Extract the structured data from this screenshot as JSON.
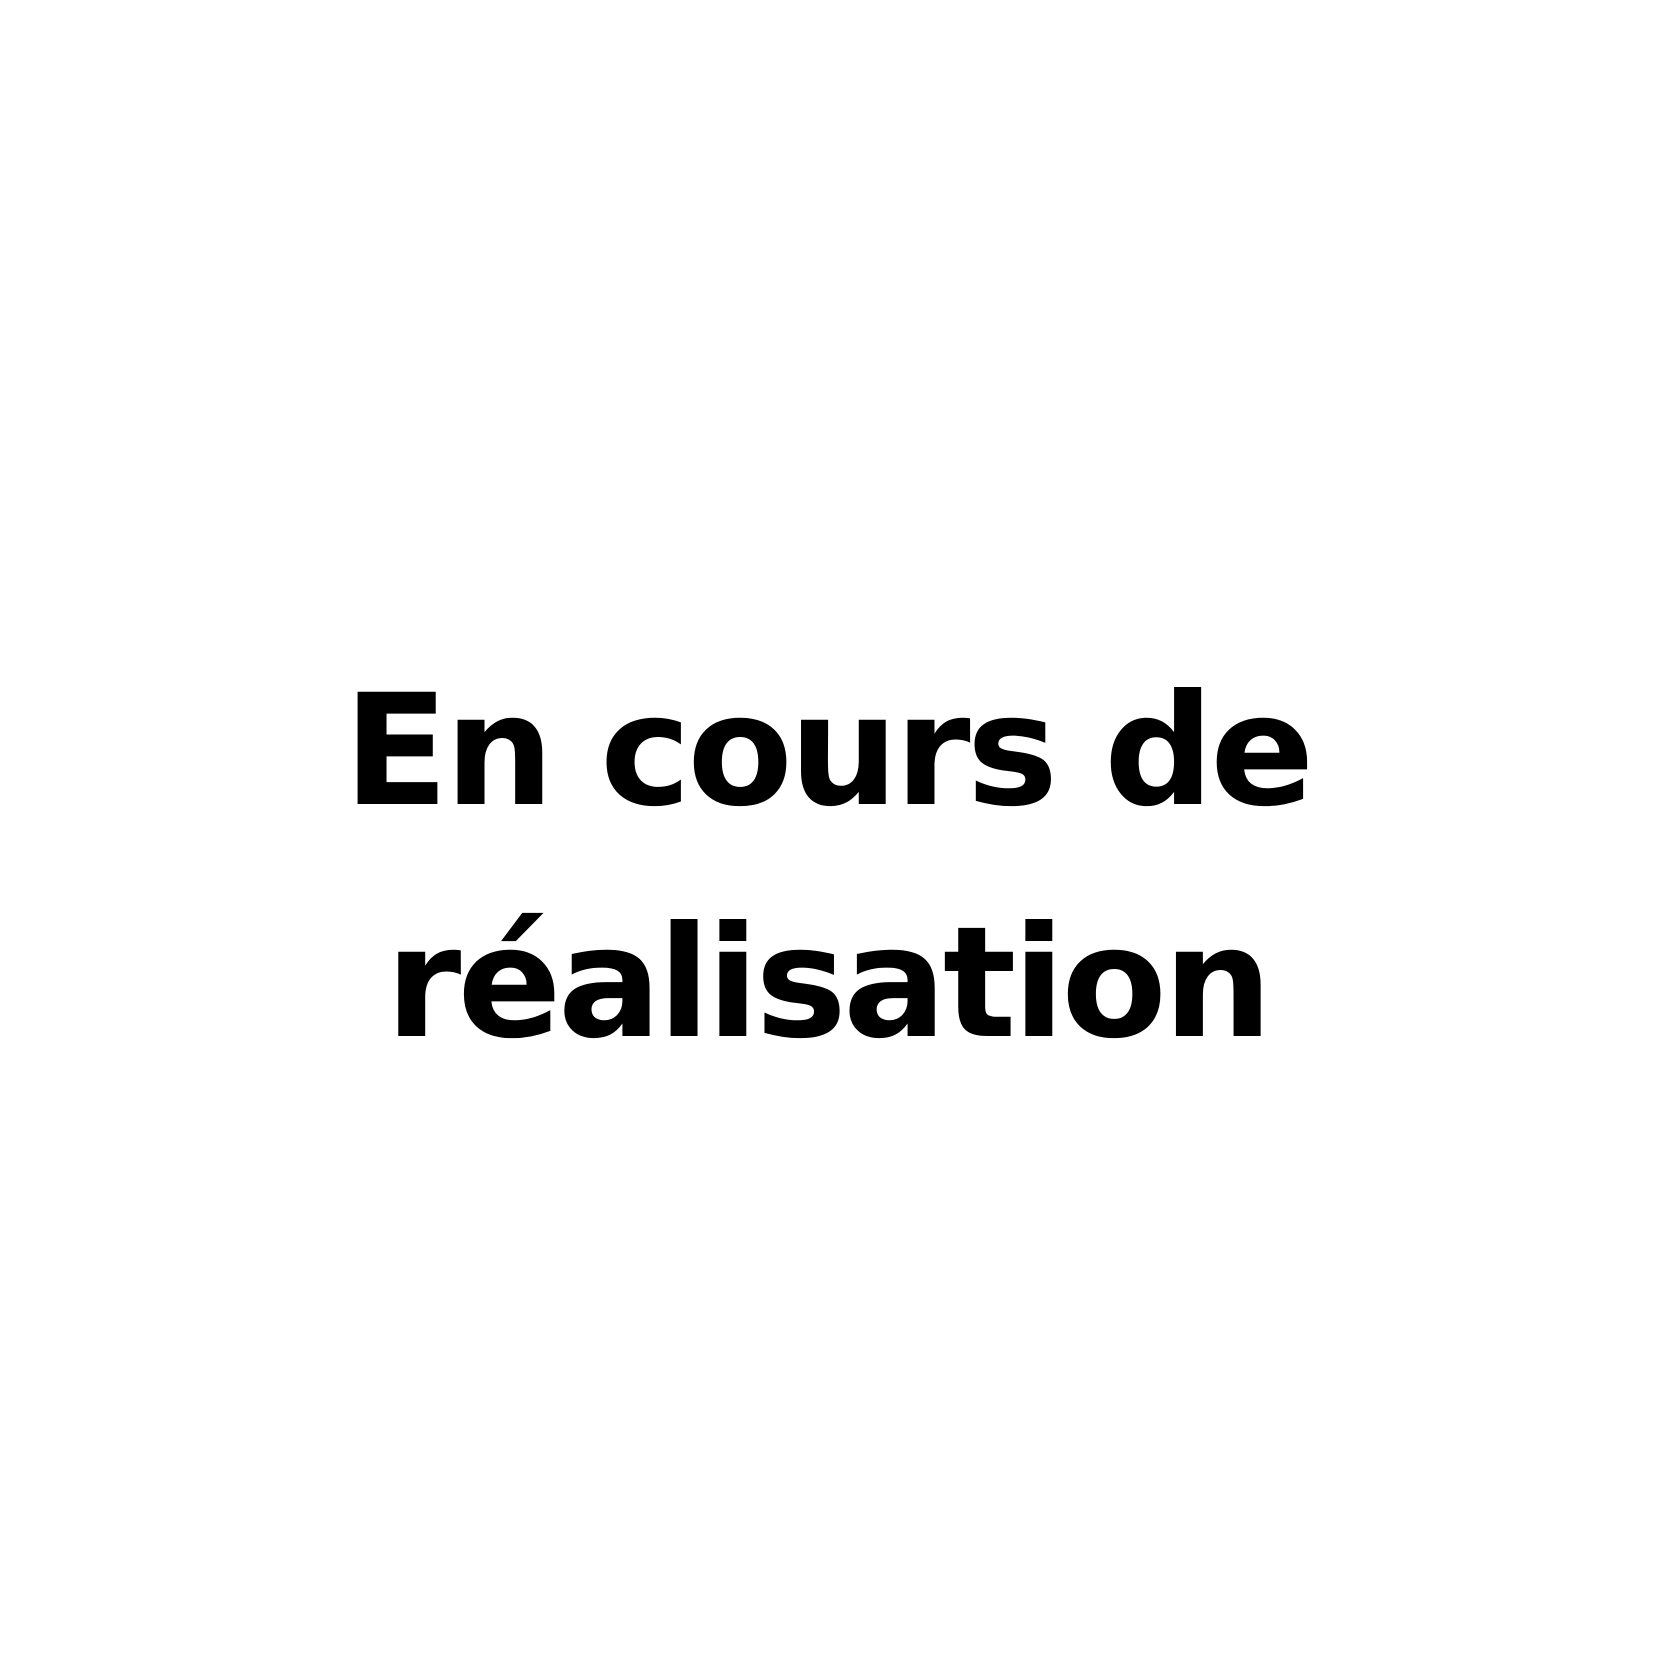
{
  "message": {
    "line1": "En cours de",
    "line2": "réalisation"
  }
}
